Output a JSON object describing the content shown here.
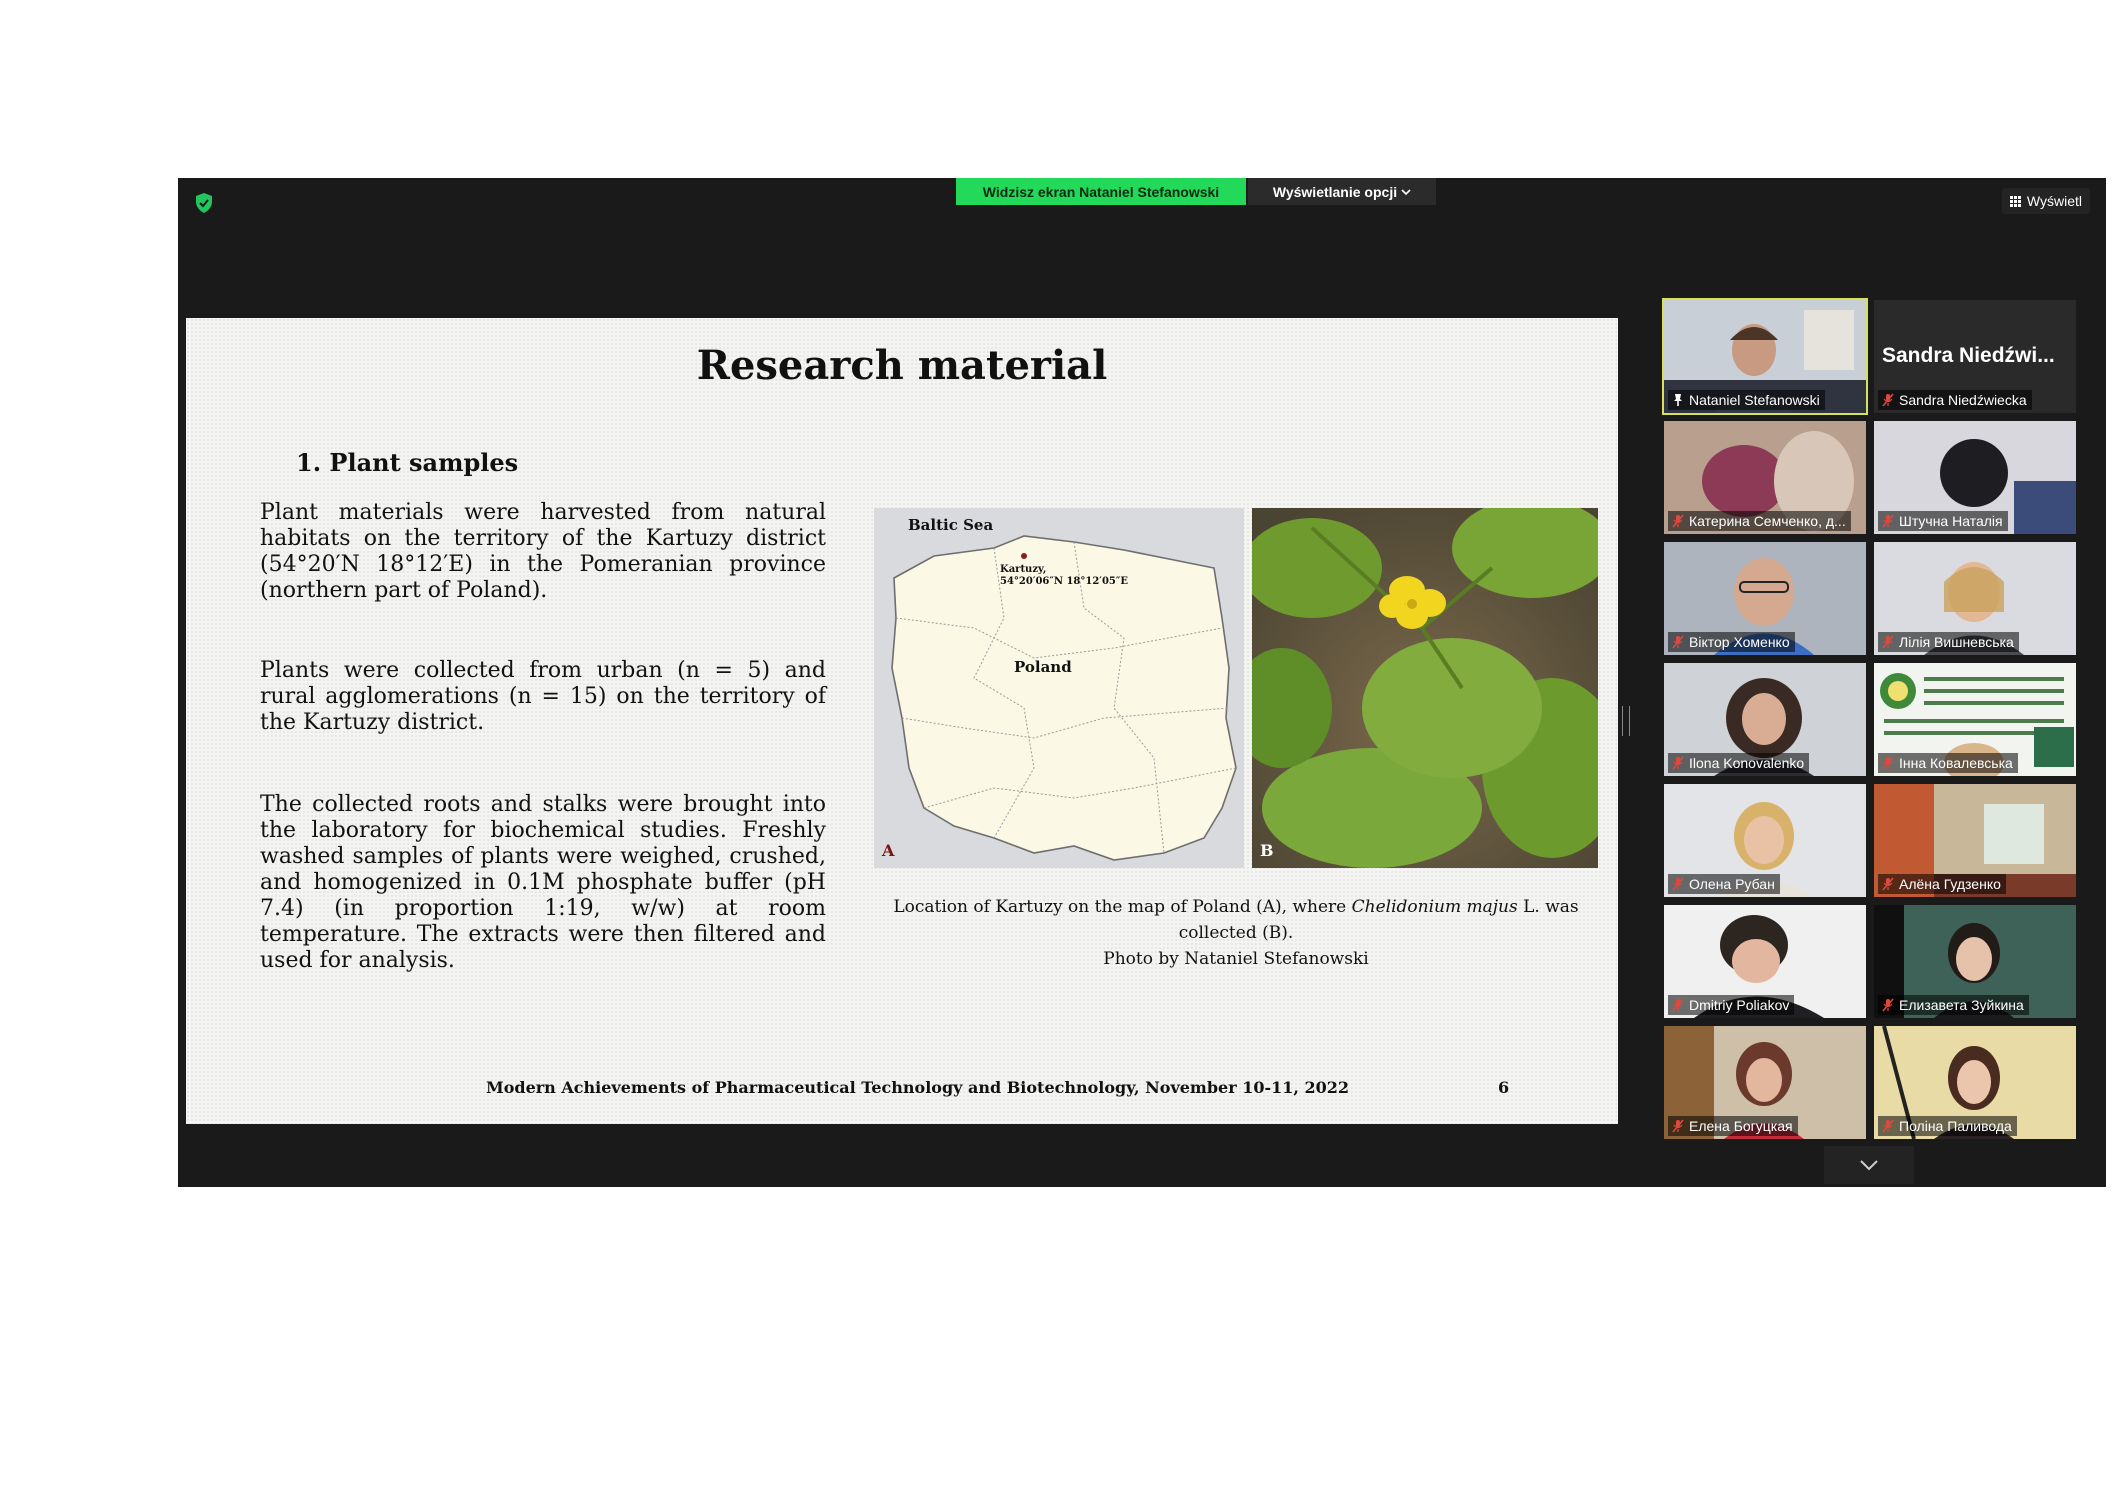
{
  "toolbar": {
    "share_banner": "Widzisz ekran Nataniel Stefanowski",
    "view_options": "Wyświetlanie opcji",
    "view_button": "Wyświetl"
  },
  "slide": {
    "title": "Research material",
    "section": "1. Plant samples",
    "paragraphs": [
      "Plant materials were harvested from natural habitats on the territory of the Kartuzy district (54°20′N 18°12′E) in the Pomeranian province (northern part of Poland).",
      "Plants were collected from urban (n = 5) and rural agglomerations (n = 15) on the territory of the Kartuzy district.",
      "The collected roots and stalks were brought into the laboratory for biochemical studies. Freshly washed samples of plants were weighed, crushed, and homogenized in 0.1M phosphate buffer (pH 7.4) (in proportion 1:19, w/w) at room temperature. The extracts were then filtered and used for analysis."
    ],
    "map": {
      "sea_label": "Baltic Sea",
      "city_label": "Kartuzy,",
      "coords_label": "54°20′06″N 18°12′05″E",
      "country_label": "Poland",
      "panel_label": "A"
    },
    "photo": {
      "panel_label": "B"
    },
    "caption": {
      "line1_pre": "Location of Kartuzy on the map of Poland (A), where ",
      "line1_italic": "Chelidonium majus",
      "line1_post": " L. was collected (B).",
      "line2": "Photo by Nataniel Stefanowski"
    },
    "footer": "Modern Achievements of Pharmaceutical Technology and Biotechnology, November 10-11, 2022",
    "page_number": "6"
  },
  "participants": [
    {
      "name": "Nataniel Stefanowski",
      "icon": "pin-icon",
      "active": true
    },
    {
      "name": "Sandra Niedźwiecka",
      "icon": "muted-mic-icon",
      "display": "Sandra  Niedźwi..."
    },
    {
      "name": "Катерина Семченко, д...",
      "icon": "muted-mic-icon"
    },
    {
      "name": "Штучна Наталія",
      "icon": "muted-mic-icon"
    },
    {
      "name": "Віктор Хоменко",
      "icon": "muted-mic-icon"
    },
    {
      "name": "Лілія Вишневська",
      "icon": "muted-mic-icon"
    },
    {
      "name": "Ilona Konovalenko",
      "icon": "muted-mic-icon"
    },
    {
      "name": "Інна Ковалевська",
      "icon": "muted-mic-icon"
    },
    {
      "name": "Олена Рубан",
      "icon": "muted-mic-icon"
    },
    {
      "name": "Алёна Гудзенко",
      "icon": "muted-mic-icon"
    },
    {
      "name": "Dmitriy Poliakov",
      "icon": "muted-mic-icon"
    },
    {
      "name": "Елизавета Зуйкина",
      "icon": "muted-mic-icon"
    },
    {
      "name": "Елена Богуцкая",
      "icon": "muted-mic-icon"
    },
    {
      "name": "Поліна Паливода",
      "icon": "muted-mic-icon"
    }
  ],
  "colors": {
    "share_green": "#23d959",
    "active_border": "#d7e356",
    "muted_red": "#e0483e"
  }
}
